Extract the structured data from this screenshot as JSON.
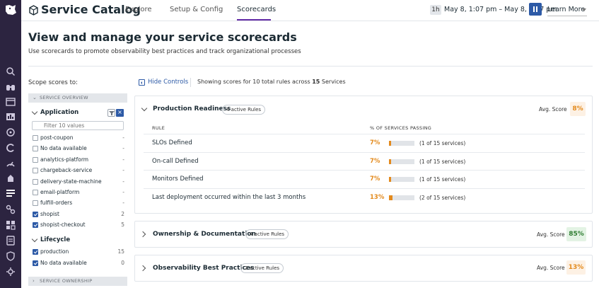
{
  "nav": {
    "icons": [
      "logo-dog-icon",
      "search-icon",
      "binoculars-icon",
      "dashboards-icon",
      "infrastructure-icon",
      "monitors-icon",
      "integrations-icon",
      "apm-icon",
      "service-catalog-icon",
      "rum-icon",
      "logs-icon",
      "security-icon",
      "settings-icon"
    ]
  },
  "header": {
    "app_title": "Service Catalog",
    "tabs": [
      {
        "label": "Explore",
        "active": false
      },
      {
        "label": "Setup & Config",
        "active": false
      },
      {
        "label": "Scorecards",
        "active": true
      }
    ],
    "time_badge": "1h",
    "time_range": "May 8, 1:07 pm – May 8, 2:07 pm",
    "learn_more": "Learn More",
    "accent_color": "#632ca6"
  },
  "page": {
    "title": "View and manage your service scorecards",
    "subtitle": "Use scorecards to promote observability best practices and track organizational processes"
  },
  "filters": {
    "scope_label": "Scope scores to:",
    "service_overview": "SERVICE OVERVIEW",
    "service_ownership": "SERVICE OWNERSHIP",
    "application_label": "Application",
    "filter_placeholder": "Filter 10 values",
    "application_items": [
      {
        "label": "post-coupon",
        "count": "-",
        "checked": false
      },
      {
        "label": "No data available",
        "count": "-",
        "checked": false
      },
      {
        "label": "analytics-platform",
        "count": "-",
        "checked": false
      },
      {
        "label": "chargeback-service",
        "count": "-",
        "checked": false
      },
      {
        "label": "delivery-state-machine",
        "count": "-",
        "checked": false
      },
      {
        "label": "email-platform",
        "count": "-",
        "checked": false
      },
      {
        "label": "fulfill-orders",
        "count": "-",
        "checked": false
      },
      {
        "label": "shopist",
        "count": "2",
        "checked": true
      },
      {
        "label": "shopist-checkout",
        "count": "5",
        "checked": true
      }
    ],
    "lifecycle_label": "Lifecycle",
    "lifecycle_items": [
      {
        "label": "production",
        "count": "15",
        "checked": true
      },
      {
        "label": "No data available",
        "count": "0",
        "checked": true
      }
    ]
  },
  "controls": {
    "hide_controls": "Hide Controls",
    "showing_prefix": "Showing scores for 10 total rules across",
    "showing_count": "15",
    "showing_suffix": "Services"
  },
  "scorecards": [
    {
      "title": "Production Readiness",
      "rules_pill": "4 active Rules",
      "avg_label": "Avg. Score",
      "avg_score": "8%",
      "score_color": "#e38a1d",
      "score_bg": "#fdf1e4",
      "expanded": true,
      "col_rule": "RULE",
      "col_passing": "% OF SERVICES PASSING",
      "rules": [
        {
          "name": "SLOs Defined",
          "pct": "7%",
          "fraction": 0.07,
          "count": "(1 of 15 services)"
        },
        {
          "name": "On-call Defined",
          "pct": "7%",
          "fraction": 0.07,
          "count": "(1 of 15 services)"
        },
        {
          "name": "Monitors Defined",
          "pct": "7%",
          "fraction": 0.07,
          "count": "(1 of 15 services)"
        },
        {
          "name": "Last deployment occurred within the last 3 months",
          "pct": "13%",
          "fraction": 0.13,
          "count": "(2 of 15 services)"
        }
      ]
    },
    {
      "title": "Ownership & Documentation",
      "rules_pill": "4 active Rules",
      "avg_label": "Avg. Score",
      "avg_score": "85%",
      "score_color": "#2f7d32",
      "score_bg": "#e3f3e4",
      "expanded": false
    },
    {
      "title": "Observability Best Practices",
      "rules_pill": "2 active Rules",
      "avg_label": "Avg. Score",
      "avg_score": "13%",
      "score_color": "#e38a1d",
      "score_bg": "#fdf1e4",
      "expanded": false
    }
  ]
}
